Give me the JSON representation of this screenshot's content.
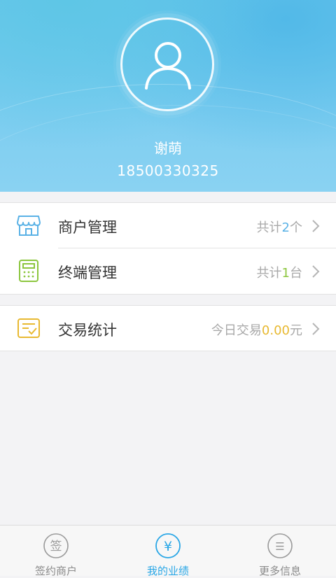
{
  "profile": {
    "name": "谢萌",
    "phone": "18500330325"
  },
  "menu": {
    "merchant": {
      "label": "商户管理",
      "prefix": "共计",
      "count": "2",
      "suffix": "个",
      "icon": "storefront-icon"
    },
    "terminal": {
      "label": "终端管理",
      "prefix": "共计",
      "count": "1",
      "suffix": "台",
      "icon": "calculator-icon"
    },
    "transaction": {
      "label": "交易统计",
      "prefix": "今日交易",
      "amount": "0.00",
      "suffix": "元",
      "icon": "bill-check-icon"
    }
  },
  "tabs": [
    {
      "label": "签约商户",
      "icon": "sign-icon",
      "glyph": "签",
      "active": false
    },
    {
      "label": "我的业绩",
      "icon": "yuan-icon",
      "glyph": "¥",
      "active": true
    },
    {
      "label": "更多信息",
      "icon": "more-icon",
      "glyph": "☰",
      "active": false
    }
  ],
  "colors": {
    "header_blue": "#6cc8ec",
    "merchant_blue": "#5ab2e6",
    "terminal_green": "#8cc63e",
    "transaction_yellow": "#e8b931",
    "active_tab": "#2aa7e6"
  }
}
